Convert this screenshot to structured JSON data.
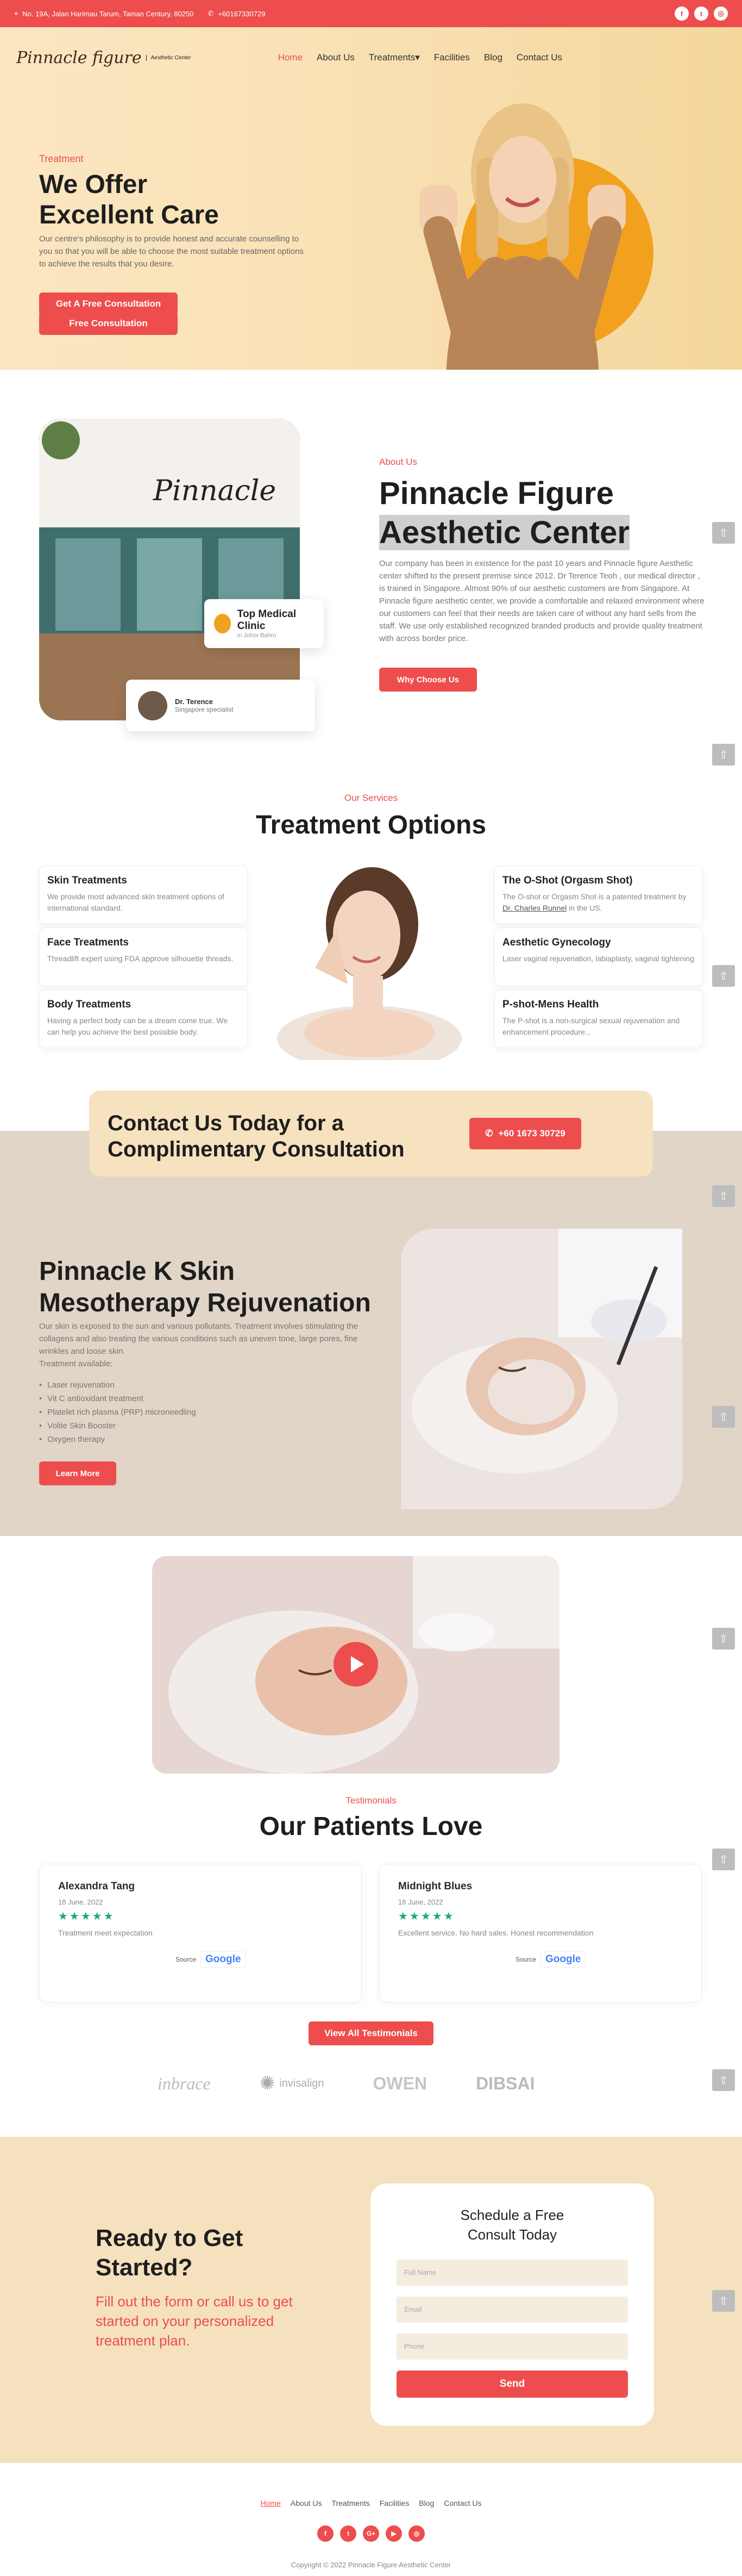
{
  "topbar": {
    "address": "No. 19A, Jalan Harimau Tarum, Taman Century, 80250",
    "phone": "+60167330729",
    "social": [
      "facebook-icon",
      "twitter-icon",
      "instagram-icon"
    ]
  },
  "nav": {
    "logo": "Pinnacle figure",
    "logo_sub": "Aesthetic Center",
    "items": [
      {
        "label": "Home",
        "active": true
      },
      {
        "label": "About Us"
      },
      {
        "label": "Treatments"
      },
      {
        "label": "Facilities"
      },
      {
        "label": "Blog"
      },
      {
        "label": "Contact Us"
      }
    ],
    "cta": "Free Consultation"
  },
  "hero": {
    "tag": "Treatment",
    "title_line1": "We Offer",
    "title_line2": "Excellent Care",
    "text": "Our centre's philosophy is to provide honest and accurate counselling to you so that you will be able to choose the most suitable treatment options to achieve the results that you desire.",
    "button": "Get A Free Consultation"
  },
  "about": {
    "tag": "About Us",
    "title_line1": "Pinnacle Figure",
    "title_line2": "Aesthetic Center",
    "text": "Our company has been in existence for the past 10 years and Pinnacle figure Aesthetic center shifted to the present premise since 2012. Dr Terence Teoh , our medical director , is trained in Singapore. Almost 90% of our aesthetic customers are from Singapore. At Pinnacle figure aesthetic center, we provide a comfortable and relaxed environment where our customers can feel that their needs are taken care of without any hard sells from the staff. We use only established recognized branded products and provide quality treatment with across border price.",
    "button": "Why Choose Us",
    "badge_title": "Top Medical Clinic",
    "badge_sub": "in Johor Bahru",
    "doctor_name": "Dr. Terence",
    "doctor_role": "Singapore specialist",
    "store_sign": "Pinnacle"
  },
  "treatments": {
    "tag": "Our Services",
    "title": "Treatment Options",
    "left": [
      {
        "title": "Skin Treatments",
        "text": "We provide most advanced skin treatment options of international standard."
      },
      {
        "title": "Face Treatments",
        "text": "Threadlift expert using FDA approve silhouette threads."
      },
      {
        "title": "Body Treatments",
        "text": "Having a perfect body can be a dream come true. We can help you achieve the best possible body."
      }
    ],
    "right": [
      {
        "title": "The O-Shot (Orgasm Shot)",
        "text_a": "The O-shot or Orgasm Shot is a patented treatment by ",
        "link": "Dr. Charles Runnel",
        "text_b": " in the US."
      },
      {
        "title": "Aesthetic Gynecology",
        "text": "Laser vaginal rejuvenation, labiaplasty, vaginal tightening"
      },
      {
        "title": "P-shot-Mens Health",
        "text": "The P-shot is a non-surgical sexual rejuvenation and enhancement procedure..."
      }
    ]
  },
  "contact": {
    "title_line1": "Contact Us Today for a",
    "title_line2": "Complimentary Consultation",
    "phone": "+60 1673 30729"
  },
  "kskin": {
    "title_line1": "Pinnacle K Skin",
    "title_line2": "Mesotherapy Rejuvenation",
    "text": "Our skin is exposed to the sun and various pollutants. Treatment involves stimulating the collagens and also treating the various conditions such as uneven tone, large pores, fine wrinkles and loose skin.",
    "available": "Treatment available:",
    "list": [
      "Laser rejuvenation",
      "Vit C antioxidant treatment",
      "Platelet rich plasma (PRP) microneedling",
      "Volite Skin Booster",
      "Oxygen therapy"
    ],
    "button": "Learn More"
  },
  "testimonials": {
    "tag": "Testimonials",
    "title": "Our Patients Love",
    "items": [
      {
        "name": "Alexandra Tang",
        "date": "18 June, 2022",
        "text": "Treatment meet expectation",
        "source": "Source",
        "brand": "Google"
      },
      {
        "name": "Midnight Blues",
        "date": "18 June, 2022",
        "text": "Excellent service. No hard sales. Honest recommendation",
        "source": "Source",
        "brand": "Google"
      }
    ],
    "button": "View All Testimonials",
    "logos": [
      "inbrace",
      "invisalign",
      "OWEN",
      "DIBSAI"
    ]
  },
  "ready": {
    "title_line1": "Ready to Get",
    "title_line2": "Started?",
    "text": "Fill out the form or call us to get started on your personalized treatment plan.",
    "form_title_line1": "Schedule a Free",
    "form_title_line2": "Consult Today",
    "name_ph": "Full Name",
    "email_ph": "Email",
    "phone_ph": "Phone",
    "submit": "Send"
  },
  "footer": {
    "links": [
      "Home",
      "About Us",
      "Treatments",
      "Facilities",
      "Blog",
      "Contact Us"
    ],
    "social": [
      "f",
      "t",
      "G+",
      "▶",
      "◎"
    ],
    "copyright": "Copyright © 2022 Pinnacle Figure Aesthetic Center"
  },
  "colors": {
    "accent": "#ee4d4d",
    "cream": "#f5e1bd",
    "beige": "#e0d5c7",
    "star": "#1aa683"
  }
}
